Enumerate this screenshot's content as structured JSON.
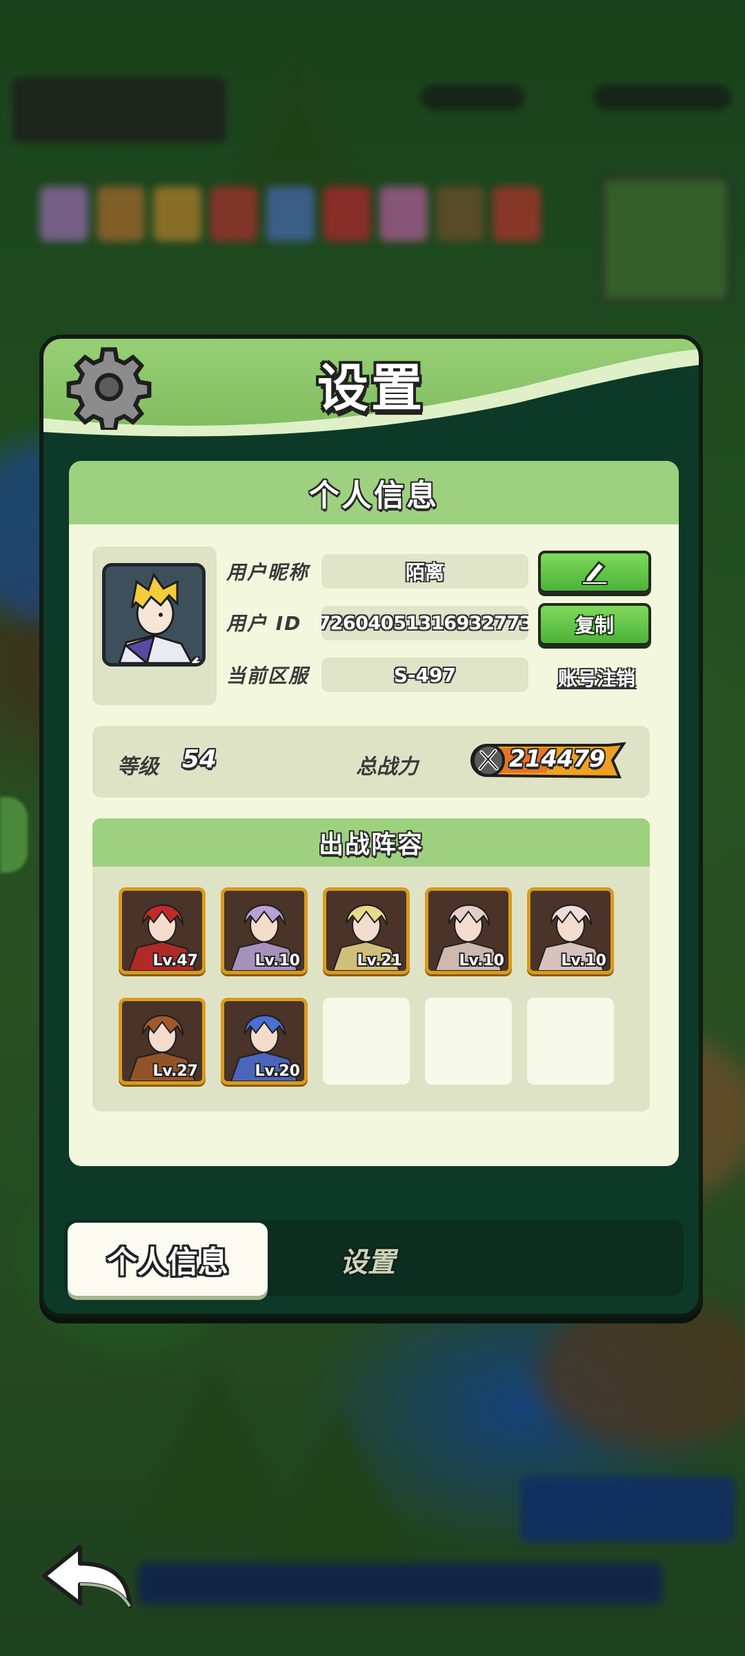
{
  "dialog": {
    "title": "设置"
  },
  "panel": {
    "header": "个人信息"
  },
  "profile": {
    "nickname_label": "用户昵称",
    "nickname": "陌离",
    "id_label": "用户 ID",
    "user_id": "7260405131693277З",
    "server_label": "当前区服",
    "server": "S-497",
    "copy_label": "复制",
    "deregister_label": "账号注销"
  },
  "stats": {
    "level_label": "等级",
    "level": "54",
    "power_label": "总战力",
    "power": "214479"
  },
  "lineup": {
    "title": "出战阵容",
    "heroes": [
      {
        "level": "Lv.47",
        "color": "#c22a2a"
      },
      {
        "level": "Lv.10",
        "color": "#b7a3d6"
      },
      {
        "level": "Lv.21",
        "color": "#e8d98a"
      },
      {
        "level": "Lv.10",
        "color": "#e4d0c8"
      },
      {
        "level": "Lv.10",
        "color": "#f0dcd8"
      },
      {
        "level": "Lv.27",
        "color": "#a05a2a"
      },
      {
        "level": "Lv.20",
        "color": "#4a6fd6"
      }
    ],
    "empty_slots": 3
  },
  "tabs": {
    "active": "个人信息",
    "inactive": "设置"
  },
  "colors": {
    "header_green": "#8fc96d",
    "button_green": "#5cc244",
    "hero_frame": "#d99b1e"
  }
}
